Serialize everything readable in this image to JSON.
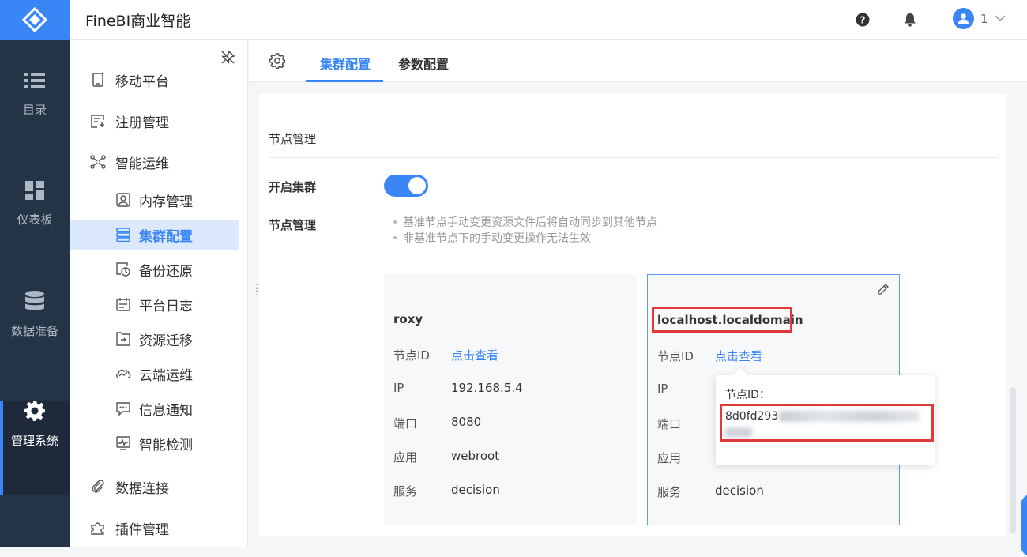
{
  "app": {
    "title": "FineBI商业智能"
  },
  "header": {
    "user_name": "1"
  },
  "rail": {
    "items": [
      {
        "label": "目录",
        "icon": "list-icon",
        "active": false
      },
      {
        "label": "仪表板",
        "icon": "dashboard-icon",
        "active": false
      },
      {
        "label": "数据准备",
        "icon": "database-icon",
        "active": false
      },
      {
        "label": "管理系统",
        "icon": "gear-icon",
        "active": true
      }
    ]
  },
  "submenu": {
    "items": [
      {
        "label": "移动平台",
        "icon": "mobile-icon"
      },
      {
        "label": "注册管理",
        "icon": "register-icon"
      },
      {
        "label": "智能运维",
        "icon": "network-icon"
      },
      {
        "label": "内存管理",
        "icon": "memory-icon"
      },
      {
        "label": "集群配置",
        "icon": "cluster-icon",
        "selected": true
      },
      {
        "label": "备份还原",
        "icon": "backup-icon"
      },
      {
        "label": "平台日志",
        "icon": "log-icon"
      },
      {
        "label": "资源迁移",
        "icon": "migrate-icon"
      },
      {
        "label": "云端运维",
        "icon": "cloud-ops-icon"
      },
      {
        "label": "信息通知",
        "icon": "message-icon"
      },
      {
        "label": "智能检测",
        "icon": "monitor-icon"
      },
      {
        "label": "数据连接",
        "icon": "link-icon"
      },
      {
        "label": "插件管理",
        "icon": "plugin-icon"
      }
    ]
  },
  "tabs": [
    {
      "label": "集群配置",
      "active": true
    },
    {
      "label": "参数配置",
      "active": false
    }
  ],
  "main": {
    "section_title": "节点管理",
    "cluster_toggle_label": "开启集群",
    "cluster_enabled": true,
    "node_mgmt_label": "节点管理",
    "hints": [
      "基准节点手动变更资源文件后将自动同步到其他节点",
      "非基准节点下的手动变更操作无法生效"
    ],
    "nodes": [
      {
        "name": "roxy",
        "rows": [
          {
            "key": "节点ID",
            "value": "点击查看",
            "link": true
          },
          {
            "key": "IP",
            "value": "192.168.5.4"
          },
          {
            "key": "端口",
            "value": "8080"
          },
          {
            "key": "应用",
            "value": "webroot"
          },
          {
            "key": "服务",
            "value": "decision"
          }
        ]
      },
      {
        "name": "localhost.localdomain",
        "rows": [
          {
            "key": "节点ID",
            "value": "点击查看",
            "link": true
          },
          {
            "key": "IP",
            "value": ""
          },
          {
            "key": "端口",
            "value": ""
          },
          {
            "key": "应用",
            "value": ""
          },
          {
            "key": "服务",
            "value": "decision"
          }
        ]
      }
    ],
    "popover": {
      "title": "节点ID：",
      "value": "8d0fd293"
    }
  },
  "colors": {
    "accent": "#3b86f7",
    "highlight": "#e0393a",
    "rail_bg": "#253347"
  }
}
